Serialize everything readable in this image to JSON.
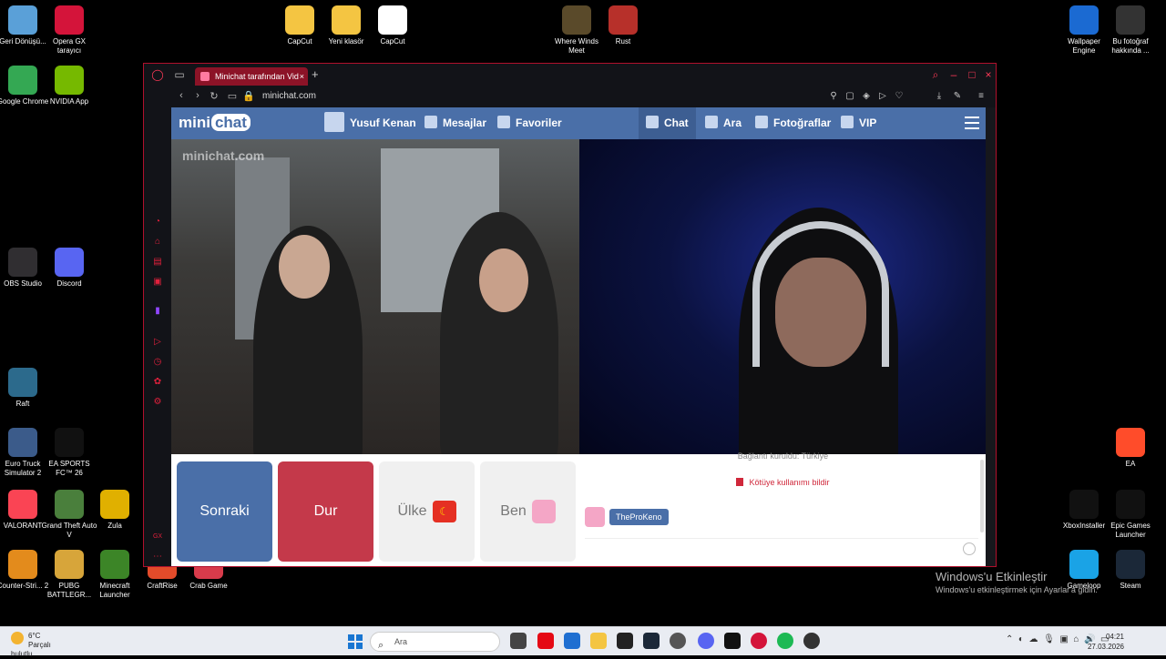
{
  "desktop": {
    "icons_left": [
      {
        "label": "Geri Dönüşü...",
        "name": "recycle-bin-icon",
        "color": "#5aa0d8"
      },
      {
        "label": "Opera GX tarayıcı",
        "name": "opera-gx-icon",
        "color": "#d4143a"
      },
      {
        "label": "Google Chrome",
        "name": "chrome-icon",
        "color": "#34a853"
      },
      {
        "label": "NVIDIA App",
        "name": "nvidia-icon",
        "color": "#76b900"
      },
      {
        "label": "OBS Studio",
        "name": "obs-icon",
        "color": "#302e31"
      },
      {
        "label": "Discord",
        "name": "discord-icon",
        "color": "#5865f2"
      },
      {
        "label": "Raft",
        "name": "raft-icon",
        "color": "#2c6a8c"
      },
      {
        "label": "Euro Truck Simulator 2",
        "name": "ets2-icon",
        "color": "#3b5b8a"
      },
      {
        "label": "EA SPORTS FC™ 26",
        "name": "eafc-icon",
        "color": "#111111"
      },
      {
        "label": "VALORANT",
        "name": "valorant-icon",
        "color": "#fa4454"
      },
      {
        "label": "Grand Theft Auto V",
        "name": "gta-icon",
        "color": "#4a7f3c"
      },
      {
        "label": "Zula",
        "name": "zula-icon",
        "color": "#e0b000"
      },
      {
        "label": "Counter-Stri... 2",
        "name": "cs2-icon",
        "color": "#e38b1c"
      },
      {
        "label": "PUBG BATTLEGR...",
        "name": "pubg-icon",
        "color": "#d7a53a"
      },
      {
        "label": "Minecraft Launcher",
        "name": "minecraft-icon",
        "color": "#3c8527"
      },
      {
        "label": "CraftRise",
        "name": "craftrise-icon",
        "color": "#e34b2a"
      },
      {
        "label": "Crab Game",
        "name": "crabgame-icon",
        "color": "#d83b4b"
      }
    ],
    "icons_top": [
      {
        "label": "CapCut",
        "name": "folder-capcut-icon",
        "color": "#f4c542"
      },
      {
        "label": "Yeni klasör",
        "name": "folder-new-icon",
        "color": "#f4c542"
      },
      {
        "label": "CapCut",
        "name": "capcut-icon",
        "color": "#ffffff"
      },
      {
        "label": "Where Winds Meet",
        "name": "where-winds-meet-icon",
        "color": "#5a4a2a"
      },
      {
        "label": "Rust",
        "name": "rust-icon",
        "color": "#b7302a"
      }
    ],
    "icons_right": [
      {
        "label": "Wallpaper Engine",
        "name": "wallpaper-engine-icon",
        "color": "#1b6ad2"
      },
      {
        "label": "Bu fotoğraf hakkında ...",
        "name": "photo-info-icon",
        "color": "#333333"
      },
      {
        "label": "EA",
        "name": "ea-icon",
        "color": "#ff4c2a"
      },
      {
        "label": "XboxInstaller",
        "name": "xbox-icon",
        "color": "#111111"
      },
      {
        "label": "Epic Games Launcher",
        "name": "epic-icon",
        "color": "#111111"
      },
      {
        "label": "Gameloop",
        "name": "gameloop-icon",
        "color": "#1aa3e6"
      },
      {
        "label": "Steam",
        "name": "steam-icon",
        "color": "#1b2838"
      }
    ]
  },
  "browser": {
    "tab_title": "Minichat tarafından Vid",
    "url": "minichat.com"
  },
  "minichat": {
    "logo_mini": "mini",
    "logo_chat": "chat",
    "user_name": "Yusuf Kenan",
    "nav_messages": "Mesajlar",
    "nav_favorites": "Favoriler",
    "nav_chat": "Chat",
    "nav_search": "Ara",
    "nav_photos": "Fotoğraflar",
    "nav_vip": "VIP",
    "watermark": "minichat.com",
    "btn_next": "Sonraki",
    "btn_stop": "Dur",
    "btn_country": "Ülke",
    "btn_me": "Ben",
    "connection_line": "Bağlantı kuruldu:  Türkiye",
    "report": "Kötüye kullanımı bildir",
    "partner_name": "TheProKeno",
    "message_placeholder": ""
  },
  "activation": {
    "title": "Windows'u Etkinleştir",
    "subtitle": "Windows'u etkinleştirmek için Ayarlar'a gidin."
  },
  "taskbar": {
    "temperature": "6°C",
    "weather": "Parçalı bulutlu",
    "search_placeholder": "Ara",
    "time": "04:21",
    "date": "27.03.2026"
  },
  "colors": {
    "accent_minichat": "#4a6fa8",
    "stop_red": "#c4394a",
    "opera_red": "#ff3a57"
  }
}
